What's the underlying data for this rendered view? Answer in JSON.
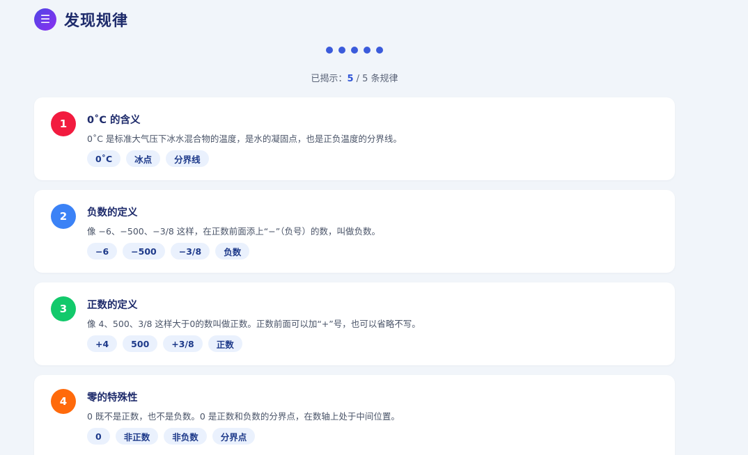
{
  "header": {
    "icon": "☰",
    "title": "发现规律"
  },
  "pagination": {
    "count": 5,
    "active": 5
  },
  "progress": {
    "prefix": "已揭示：",
    "current": "5",
    "separator": " / ",
    "total": "5",
    "suffix": " 条规律"
  },
  "colors": {
    "card1": "#f21b3f",
    "card2": "#3b82f6",
    "card3": "#12c96b",
    "card4": "#ff6a0b",
    "accent": "#3b5bdb"
  },
  "cards": [
    {
      "num": "1",
      "title": "0˚C 的含义",
      "desc": "0˚C 是标准大气压下冰水混合物的温度，是水的凝固点，也是正负温度的分界线。",
      "tags": [
        "0˚C",
        "冰点",
        "分界线"
      ]
    },
    {
      "num": "2",
      "title": "负数的定义",
      "desc": "像 −6、−500、−3/8 这样，在正数前面添上“−”（负号）的数，叫做负数。",
      "tags": [
        "−6",
        "−500",
        "−3/8",
        "负数"
      ]
    },
    {
      "num": "3",
      "title": "正数的定义",
      "desc": "像 4、500、3/8 这样大于0的数叫做正数。正数前面可以加“+”号，也可以省略不写。",
      "tags": [
        "+4",
        "500",
        "+3/8",
        "正数"
      ]
    },
    {
      "num": "4",
      "title": "零的特殊性",
      "desc": "0 既不是正数，也不是负数。0 是正数和负数的分界点，在数轴上处于中间位置。",
      "tags": [
        "0",
        "非正数",
        "非负数",
        "分界点"
      ]
    }
  ]
}
